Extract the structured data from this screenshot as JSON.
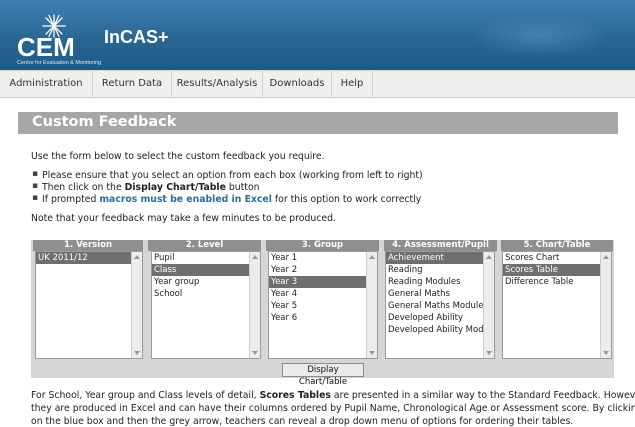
{
  "header": {
    "logo_text": "CEM",
    "logo_subtitle": "Centre for Evaluation & Monitoring",
    "app_name": "InCAS+"
  },
  "nav": {
    "items": [
      "Administration",
      "Return Data",
      "Results/Analysis",
      "Downloads",
      "Help"
    ]
  },
  "page": {
    "title": "Custom Feedback",
    "intro": "Use the form below to select the custom feedback you require.",
    "bullets": [
      {
        "pre": "Please ensure that you select an option from each box (working from left to right)",
        "em": "",
        "post": ""
      },
      {
        "pre": "Then click on the ",
        "em": "Display Chart/Table",
        "post": " button"
      },
      {
        "pre": "If prompted ",
        "em": "macros must be enabled in Excel",
        "post": " for this option to work correctly"
      }
    ],
    "note": "Note that your feedback may take a few minutes to be produced.",
    "footer_lines": [
      {
        "pre": "For School, Year group and Class levels of detail, ",
        "em": "Scores Tables",
        "post": " are presented in a similar way to the Standard Feedback.  However,"
      },
      {
        "pre": "they are produced in Excel and can have their columns ordered by Pupil Name, Chronological Age or Assessment score.  By clicking",
        "em": "",
        "post": ""
      },
      {
        "pre": "on the blue box and then the grey arrow, teachers can reveal a drop down menu of options for ordering their tables.",
        "em": "",
        "post": ""
      }
    ]
  },
  "selector": {
    "columns": [
      {
        "header": "1. Version",
        "options": [
          "UK 2011/12"
        ],
        "selected": 0
      },
      {
        "header": "2. Level",
        "options": [
          "Pupil",
          "Class",
          "Year group",
          "School"
        ],
        "selected": 1
      },
      {
        "header": "3. Group",
        "options": [
          "Year 1",
          "Year 2",
          "Year 3",
          "Year 4",
          "Year 5",
          "Year 6"
        ],
        "selected": 2
      },
      {
        "header": "4. Assessment/Pupil",
        "options": [
          "Achievement",
          "Reading",
          "Reading Modules",
          "General Maths",
          "General Maths Modules",
          "Developed Ability",
          "Developed Ability Mod"
        ],
        "selected": 0
      },
      {
        "header": "5. Chart/Table",
        "options": [
          "Scores Chart",
          "Scores Table",
          "Difference Table"
        ],
        "selected": 1
      }
    ],
    "button_label": "Display Chart/Table"
  },
  "colors": {
    "header_blue": "#2a6694",
    "link_blue": "#2e6a9a",
    "title_bar_grey": "#a6a6a6",
    "selected_option": "#6f6f6f"
  }
}
